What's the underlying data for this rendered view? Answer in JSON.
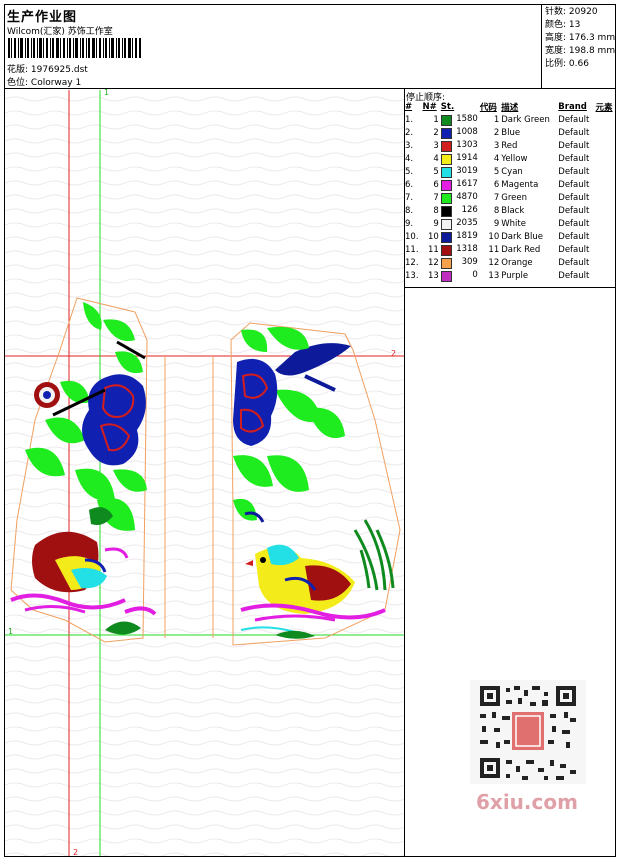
{
  "header": {
    "title": "生产作业图",
    "studio": "Wilcom(汇家) 苏饰工作室",
    "design_label": "花版:",
    "design_value": "1976925.dst",
    "colorway_label": "色位:",
    "colorway_value": "Colorway 1"
  },
  "info": {
    "stitches_label": "针数:",
    "stitches_value": "20920",
    "colors_label": "颜色:",
    "colors_value": "13",
    "height_label": "高度:",
    "height_value": "176.3 mm",
    "width_label": "宽度:",
    "width_value": "198.8 mm",
    "scale_label": "比例:",
    "scale_value": "0.66"
  },
  "stops": {
    "title": "停止顺序:",
    "headers": [
      "#",
      "N#",
      "St.",
      "代码",
      "描述",
      "Brand",
      "元素"
    ],
    "rows": [
      {
        "idx": "1.",
        "n": "1",
        "st": "1580",
        "code": "1",
        "desc": "Dark Green",
        "brand": "Default",
        "color": "#0f8a1e"
      },
      {
        "idx": "2.",
        "n": "2",
        "st": "1008",
        "code": "2",
        "desc": "Blue",
        "brand": "Default",
        "color": "#1020b0"
      },
      {
        "idx": "3.",
        "n": "3",
        "st": "1303",
        "code": "3",
        "desc": "Red",
        "brand": "Default",
        "color": "#d21e1e"
      },
      {
        "idx": "4.",
        "n": "4",
        "st": "1914",
        "code": "4",
        "desc": "Yellow",
        "brand": "Default",
        "color": "#f4ec1a"
      },
      {
        "idx": "5.",
        "n": "5",
        "st": "3019",
        "code": "5",
        "desc": "Cyan",
        "brand": "Default",
        "color": "#23e0e6"
      },
      {
        "idx": "6.",
        "n": "6",
        "st": "1617",
        "code": "6",
        "desc": "Magenta",
        "brand": "Default",
        "color": "#e21ee2"
      },
      {
        "idx": "7.",
        "n": "7",
        "st": "4870",
        "code": "7",
        "desc": "Green",
        "brand": "Default",
        "color": "#1eec1e"
      },
      {
        "idx": "8.",
        "n": "8",
        "st": "126",
        "code": "8",
        "desc": "Black",
        "brand": "Default",
        "color": "#000000"
      },
      {
        "idx": "9.",
        "n": "9",
        "st": "2035",
        "code": "9",
        "desc": "White",
        "brand": "Default",
        "color": "#f2f2f2"
      },
      {
        "idx": "10.",
        "n": "10",
        "st": "1819",
        "code": "10",
        "desc": "Dark Blue",
        "brand": "Default",
        "color": "#0d1a9a"
      },
      {
        "idx": "11.",
        "n": "11",
        "st": "1318",
        "code": "11",
        "desc": "Dark Red",
        "brand": "Default",
        "color": "#a01010"
      },
      {
        "idx": "12.",
        "n": "12",
        "st": "309",
        "code": "12",
        "desc": "Orange",
        "brand": "Default",
        "color": "#f5a04a"
      },
      {
        "idx": "13.",
        "n": "13",
        "st": "0",
        "code": "13",
        "desc": "Purple",
        "brand": "Default",
        "color": "#c030c0"
      }
    ]
  },
  "axes": {
    "marker_1": "1",
    "marker_2": "2"
  },
  "watermark": "6xiu.com"
}
